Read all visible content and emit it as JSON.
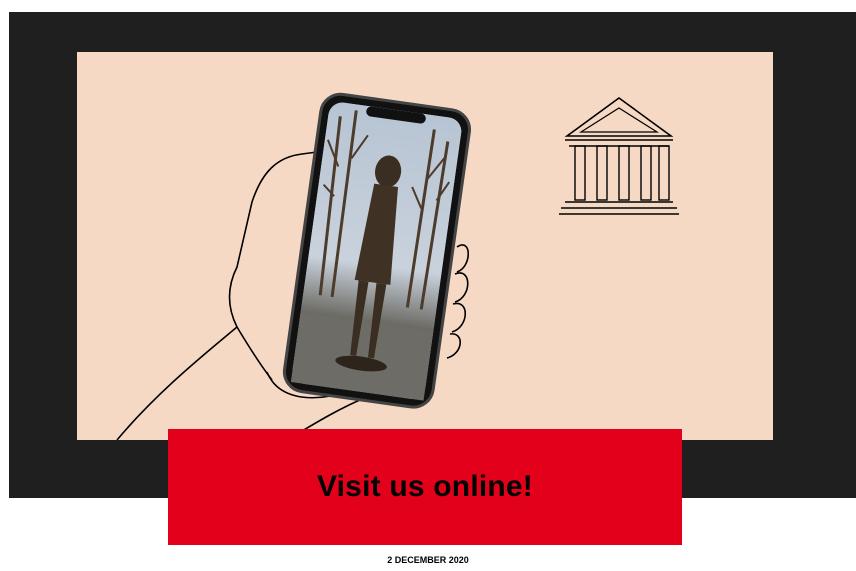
{
  "banner": {
    "text": "Visit us online!",
    "color": "#e2001a"
  },
  "date": {
    "text": "2 DECEMBER 2020"
  },
  "colors": {
    "frame": "#1f1f1f",
    "panel": "#f6d9c5"
  },
  "illustration": {
    "hand_icon": "hand-holding-phone-icon",
    "screen_image": "statue-photo",
    "building_icon": "museum-icon"
  }
}
